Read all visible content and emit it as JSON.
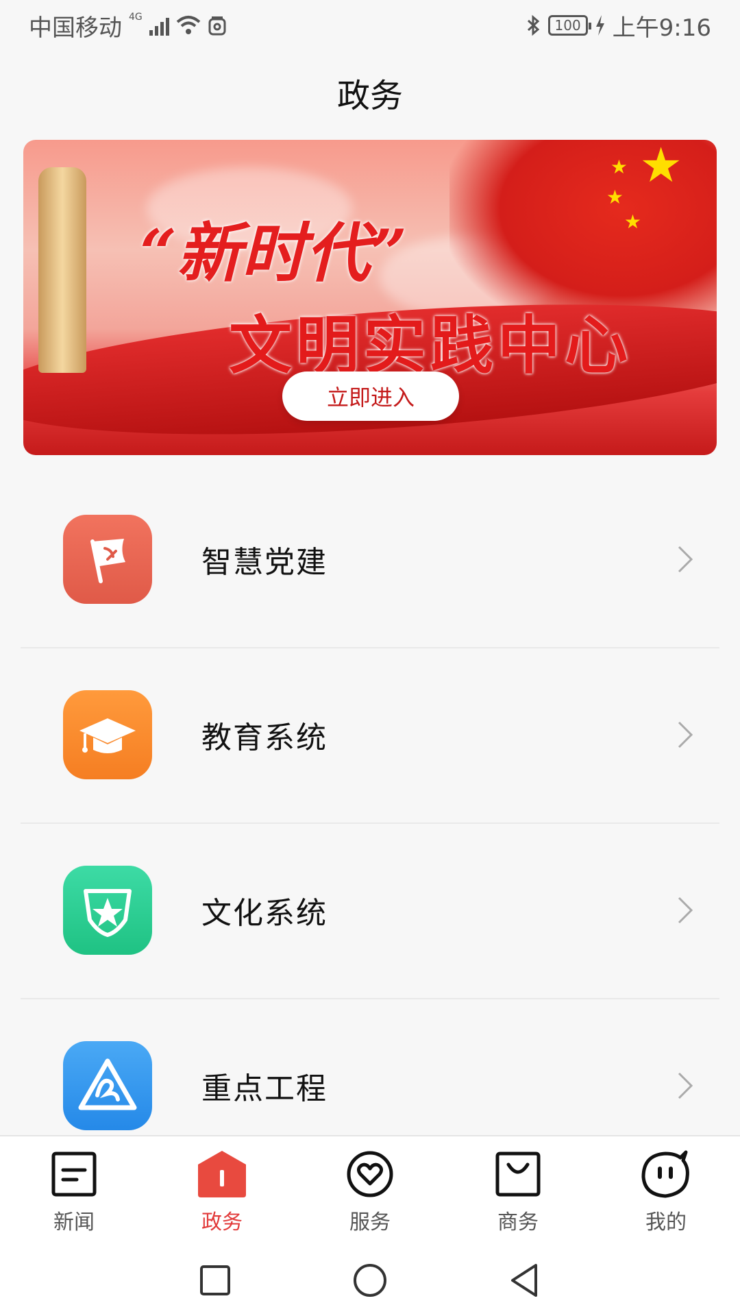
{
  "status_bar": {
    "carrier": "中国移动",
    "network": "4G",
    "battery": "100",
    "time": "上午9:16"
  },
  "page": {
    "title": "政务"
  },
  "banner": {
    "headline": "“新时代”",
    "subheadline": "文明实践中心",
    "button_label": "立即进入"
  },
  "menu": {
    "items": [
      {
        "label": "智慧党建",
        "icon": "party-flag-icon",
        "color_top": "#f1735e",
        "color_bottom": "#e05a48"
      },
      {
        "label": "教育系统",
        "icon": "graduation-cap-icon",
        "color_top": "#ff9a3c",
        "color_bottom": "#f57e22"
      },
      {
        "label": "文化系统",
        "icon": "star-shield-icon",
        "color_top": "#3ddba5",
        "color_bottom": "#1fc283"
      },
      {
        "label": "重点工程",
        "icon": "project-logo-icon",
        "color_top": "#4aa9f5",
        "color_bottom": "#2589e8"
      }
    ]
  },
  "bottom_nav": {
    "active_color": "#e23a3a",
    "items": [
      {
        "label": "新闻",
        "icon": "news-icon"
      },
      {
        "label": "政务",
        "icon": "government-icon"
      },
      {
        "label": "服务",
        "icon": "service-heart-icon"
      },
      {
        "label": "商务",
        "icon": "shopping-bag-icon"
      },
      {
        "label": "我的",
        "icon": "profile-face-icon"
      }
    ]
  }
}
